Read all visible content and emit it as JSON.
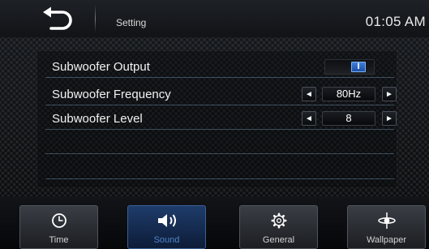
{
  "header": {
    "title": "Setting",
    "clock": "01:05 AM"
  },
  "settings": [
    {
      "label": "Subwoofer Output",
      "control": "toggle",
      "state": "on",
      "knob_text": "I"
    },
    {
      "label": "Subwoofer Frequency",
      "control": "stepper",
      "value": "80Hz",
      "prev": "◄",
      "next": "►"
    },
    {
      "label": "Subwoofer Level",
      "control": "stepper",
      "value": "8",
      "prev": "◄",
      "next": "►"
    }
  ],
  "nav": {
    "active": "Sound",
    "tabs": [
      {
        "label": "Time",
        "icon": "clock-icon"
      },
      {
        "label": "Sound",
        "icon": "speaker-icon"
      },
      {
        "label": "General",
        "icon": "gear-icon"
      },
      {
        "label": "Wallpaper",
        "icon": "wallpaper-icon"
      }
    ]
  },
  "colors": {
    "accent": "#3f7fd9",
    "active_tab": "#1e3c6a",
    "active_tab_label": "#4f84c8",
    "row_divider": "#96bee6"
  }
}
